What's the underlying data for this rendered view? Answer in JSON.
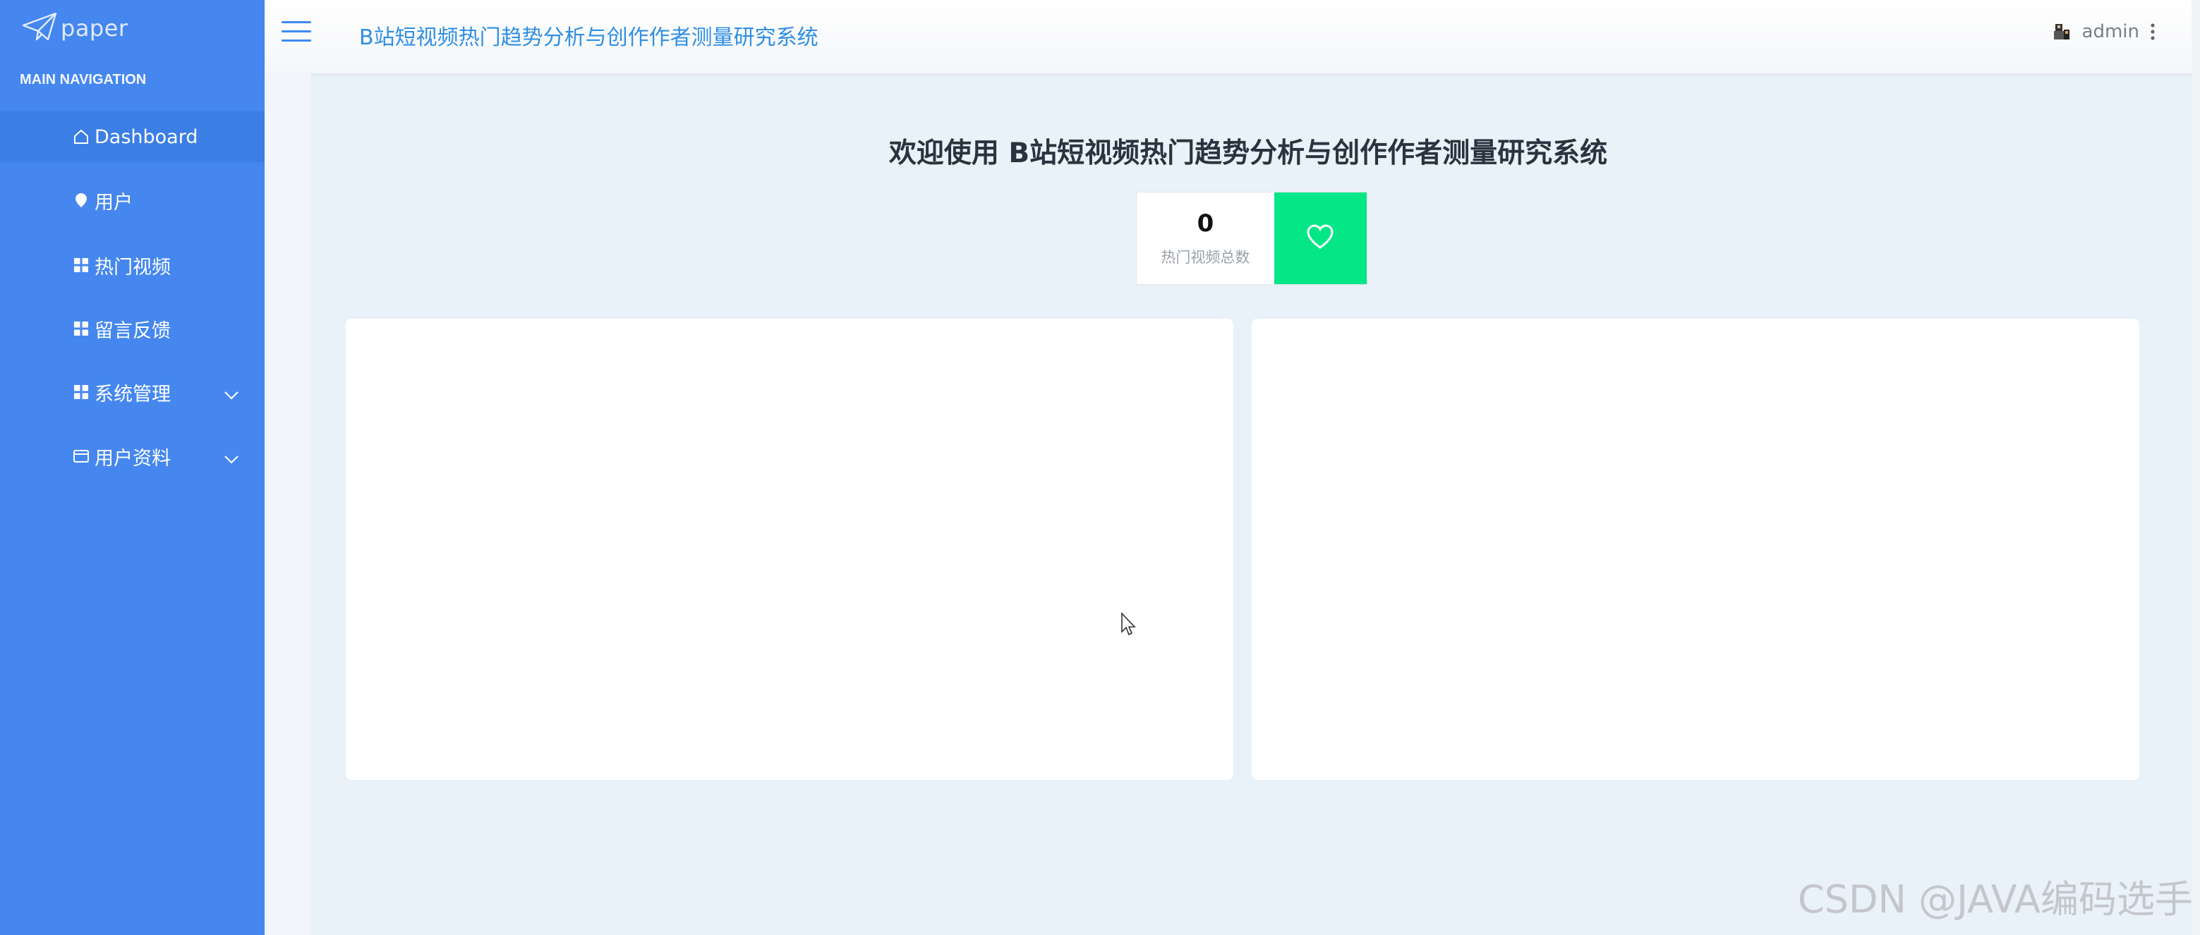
{
  "app": {
    "logo_text": "paper",
    "header_title": "B站短视频热门趋势分析与创作作者测量研究系统"
  },
  "sidebar": {
    "heading": "MAIN NAVIGATION",
    "items": [
      {
        "label": "Dashboard",
        "icon": "home-icon",
        "active": true
      },
      {
        "label": "用户",
        "icon": "pin-icon"
      },
      {
        "label": "热门视频",
        "icon": "grid-icon"
      },
      {
        "label": "留言反馈",
        "icon": "grid-icon"
      },
      {
        "label": "系统管理",
        "icon": "grid-icon",
        "expandable": true
      },
      {
        "label": "用户资料",
        "icon": "card-icon",
        "expandable": true
      }
    ]
  },
  "user": {
    "name": "admin"
  },
  "main": {
    "welcome": "欢迎使用 B站短视频热门趋势分析与创作作者测量研究系统",
    "stat": {
      "value": "0",
      "label": "热门视频总数",
      "accent": "#05e686"
    }
  },
  "watermark": "CSDN @JAVA编码选手",
  "colors": {
    "sidebar": "#4587ef",
    "active_item": "#3b7ee6",
    "header_title": "#2f8fe4",
    "background": "#e9f1f9"
  }
}
